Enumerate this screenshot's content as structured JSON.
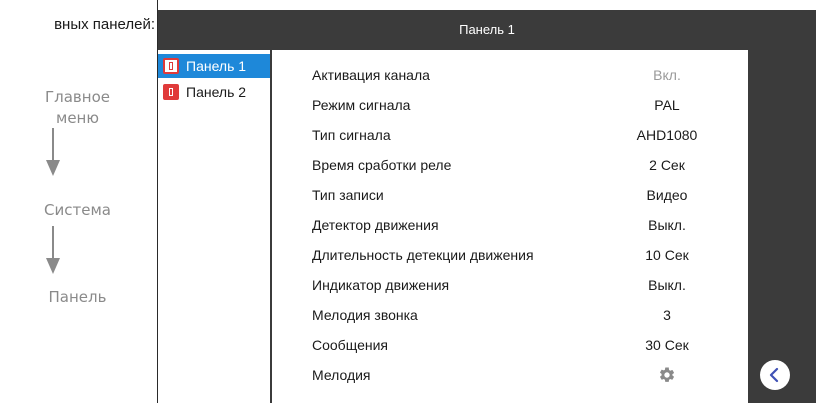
{
  "guide": {
    "heading": "вных панелей:",
    "steps": [
      "Главное меню",
      "Система",
      "Панель"
    ],
    "step1_line1": "Главное",
    "step1_line2": "меню"
  },
  "screen": {
    "title": "Панель 1",
    "panels": [
      {
        "label": "Панель 1",
        "selected": true
      },
      {
        "label": "Панель 2",
        "selected": false
      }
    ],
    "settings": [
      {
        "label": "Активация канала",
        "value": "Вкл."
      },
      {
        "label": "Режим сигнала",
        "value": "PAL"
      },
      {
        "label": "Тип сигнала",
        "value": "AHD1080"
      },
      {
        "label": "Время сработки реле",
        "value": "2 Сек"
      },
      {
        "label": "Тип записи",
        "value": "Видео"
      },
      {
        "label": "Детектор движения",
        "value": "Выкл."
      },
      {
        "label": "Длительность детекции движения",
        "value": "10 Сек"
      },
      {
        "label": "Индикатор движения",
        "value": "Выкл."
      },
      {
        "label": "Мелодия звонка",
        "value": "3"
      },
      {
        "label": "Сообщения",
        "value": "30 Сек"
      },
      {
        "label": "Мелодия",
        "value_icon": "gear-icon"
      }
    ]
  },
  "icons": {
    "back": "chevron-left-icon",
    "panel": "door-icon",
    "settings": "gear-icon"
  },
  "colors": {
    "screen_bg": "#3b3b3b",
    "selected": "#1e88d9",
    "panel_icon": "#e03a3a",
    "back_chevron": "#3f51b5"
  }
}
